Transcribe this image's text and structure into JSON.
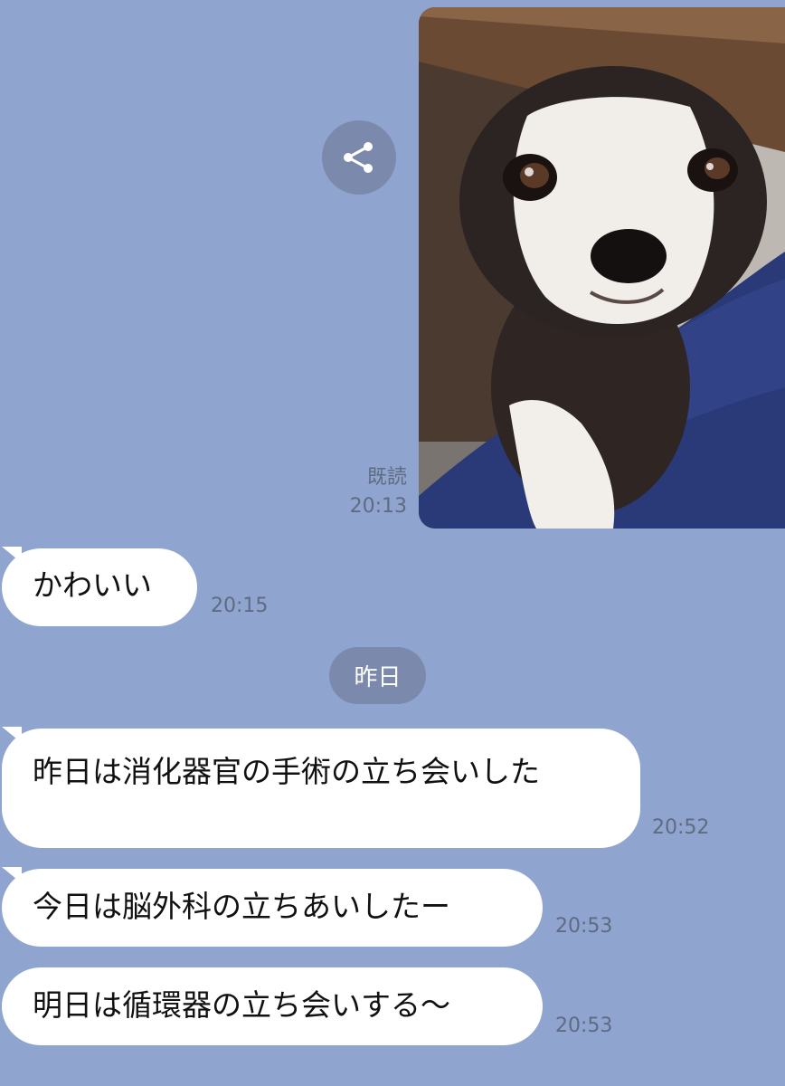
{
  "sent_message": {
    "read_label": "既読",
    "time": "20:13",
    "photo_subject": "dog-photo"
  },
  "share_icon": "share-icon",
  "messages": [
    {
      "text": "かわいい",
      "time": "20:15"
    },
    {
      "text": "昨日は消化器官の手術の立ち会いした",
      "time": "20:52"
    },
    {
      "text": "今日は脳外科の立ちあいしたー",
      "time": "20:53"
    },
    {
      "text": "明日は循環器の立ち会いする〜",
      "time": "20:53"
    }
  ],
  "date_separator": "昨日",
  "colors": {
    "chat_background": "#8fa5cf",
    "bubble": "#ffffff",
    "pill": "#7b8aac"
  }
}
